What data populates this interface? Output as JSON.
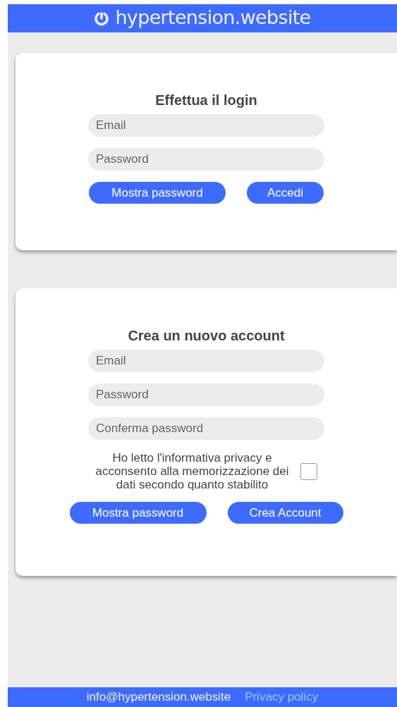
{
  "header": {
    "logo": "hypertension.website"
  },
  "login": {
    "title": "Effettua il login",
    "fields": [
      {
        "placeholder": "Email"
      },
      {
        "placeholder": "Password"
      }
    ],
    "buttons": [
      "Mostra password",
      "Accedi"
    ]
  },
  "signup": {
    "title": "Crea un nuovo account",
    "fields": [
      {
        "placeholder": "Email"
      },
      {
        "placeholder": "Password"
      },
      {
        "placeholder": "Conferma password"
      }
    ],
    "consent": {
      "label": "Ho letto l'informativa privacy e acconsento alla memorizzazione dei dati secondo quanto stabilito",
      "checked": false
    },
    "buttons": [
      "Mostra password",
      "Crea Account"
    ]
  },
  "footer": {
    "email": "info@hypertension.website",
    "link": "Privacy policy"
  }
}
